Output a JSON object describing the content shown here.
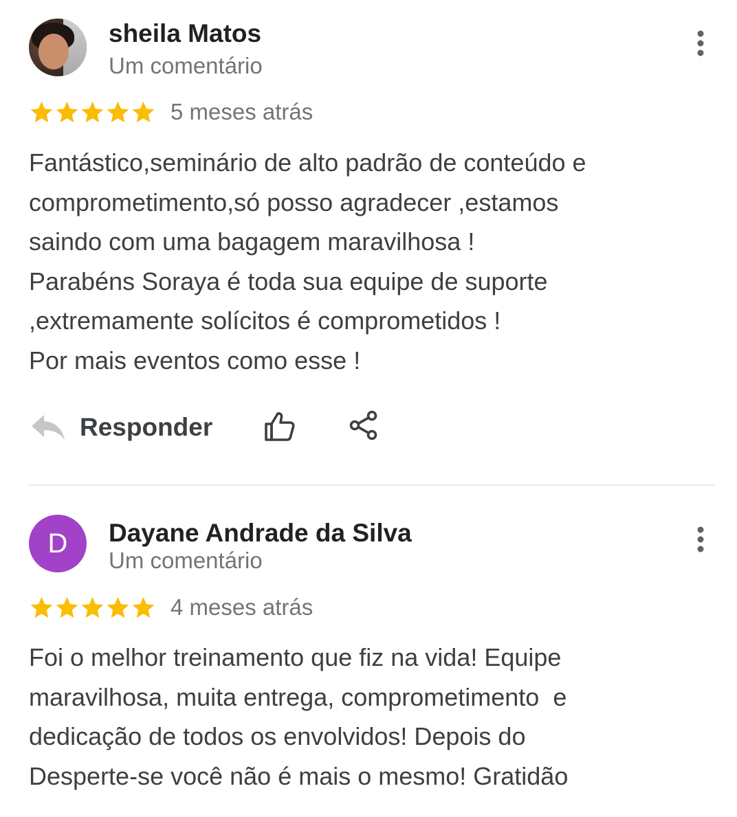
{
  "colors": {
    "star": "#fbbc04",
    "avatar_letter_bg": "#a142c8",
    "secondary_text": "#70757a",
    "divider": "#e8eaed"
  },
  "reviews": [
    {
      "author": "sheila Matos",
      "subtitle": "Um comentário",
      "avatar": {
        "type": "photo",
        "icon": "avatar-photo"
      },
      "rating": 5,
      "time": "5 meses atrás",
      "body_lines": [
        "Fantástico,seminário de alto padrão de conteúdo e",
        "comprometimento,só posso agradecer ,estamos",
        "saindo com uma bagagem maravilhosa !",
        "Parabéns Soraya é toda sua equipe de suporte",
        ",extremamente solícitos é comprometidos !",
        "Por mais eventos como esse !"
      ],
      "actions": {
        "reply_label": "Responder",
        "reply_icon": "reply-icon",
        "like_icon": "thumbs-up-icon",
        "share_icon": "share-icon"
      }
    },
    {
      "author": "Dayane Andrade da Silva",
      "subtitle": "Um comentário",
      "avatar": {
        "type": "letter",
        "letter": "D"
      },
      "rating": 5,
      "time": "4 meses atrás",
      "body_lines": [
        "Foi o melhor treinamento que fiz na vida! Equipe",
        "maravilhosa, muita entrega, comprometimento  e",
        "dedicação de todos os envolvidos! Depois do",
        "Desperte-se você não é mais o mesmo! Gratidão"
      ]
    }
  ]
}
